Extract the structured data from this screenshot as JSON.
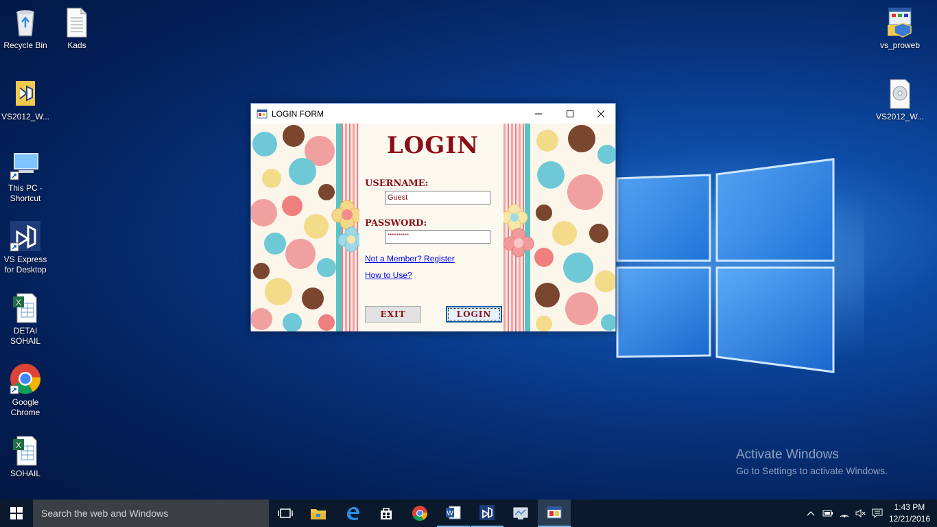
{
  "desktop": {
    "icons": [
      {
        "label": "Recycle Bin"
      },
      {
        "label": "Kads"
      },
      {
        "label": "VS2012_W..."
      },
      {
        "label": "This PC - Shortcut"
      },
      {
        "label": "VS Express for Desktop"
      },
      {
        "label": "DETAI SOHAIL"
      },
      {
        "label": "Google Chrome"
      },
      {
        "label": "SOHAIL"
      },
      {
        "label": "vs_proweb"
      },
      {
        "label": "VS2012_W..."
      }
    ],
    "watermark": {
      "title": "Activate Windows",
      "subtitle": "Go to Settings to activate Windows."
    }
  },
  "window": {
    "title": "LOGIN FORM",
    "heading": "LOGIN",
    "username_label": "USERNAME:",
    "username_value": "Guest",
    "password_label": "PASSWORD:",
    "password_value": "**********",
    "register_link": "Not a Member? Register",
    "howto_link": "How to Use?",
    "exit_button": "EXIT",
    "login_button": "LOGIN"
  },
  "taskbar": {
    "search_placeholder": "Search the web and Windows",
    "time": "1:43 PM",
    "date": "12/21/2016"
  }
}
